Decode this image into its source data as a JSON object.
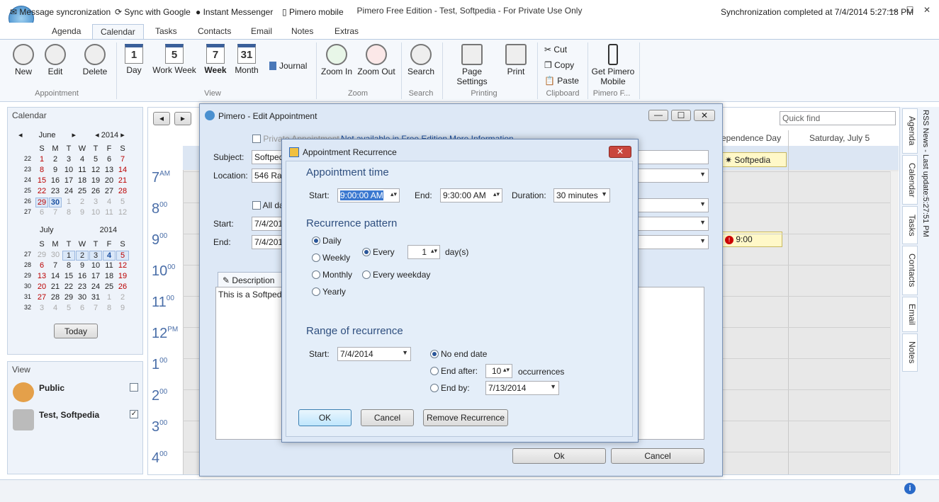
{
  "app": {
    "title": "Pimero Free Edition - Test, Softpedia - For Private Use Only"
  },
  "tabs": [
    "Agenda",
    "Calendar",
    "Tasks",
    "Contacts",
    "Email",
    "Notes",
    "Extras"
  ],
  "ribbon": {
    "new": "New",
    "edit": "Edit",
    "delete": "Delete",
    "group_appointment": "Appointment",
    "day": "Day",
    "work_week": "Work Week",
    "week": "Week",
    "month": "Month",
    "journal": "Journal",
    "group_view": "View",
    "day_num": "1",
    "work_week_num": "5",
    "week_num": "7",
    "month_num": "31",
    "zoom_in": "Zoom In",
    "zoom_out": "Zoom Out",
    "group_zoom": "Zoom",
    "search": "Search",
    "group_search": "Search",
    "page_settings": "Page Settings",
    "print": "Print",
    "group_printing": "Printing",
    "cut": "Cut",
    "copy": "Copy",
    "paste": "Paste",
    "group_clipboard": "Clipboard",
    "get_mobile": "Get Pimero Mobile",
    "group_pimero": "Pimero F..."
  },
  "calendar_pane": {
    "title": "Calendar",
    "today": "Today",
    "june": {
      "month": "June",
      "year": "2014"
    },
    "july": {
      "month": "July",
      "year": "2014"
    },
    "weekdays": [
      "S",
      "M",
      "T",
      "W",
      "T",
      "F",
      "S"
    ]
  },
  "view_pane": {
    "title": "View",
    "items": [
      {
        "label": "Public"
      },
      {
        "label": "Test, Softpedia"
      }
    ]
  },
  "main": {
    "quick_find": "Quick find",
    "col_independence": "ependence Day",
    "col_saturday": "Saturday, July 5",
    "event_softpedia": "Softpedia",
    "event_900": "9:00",
    "hours": [
      {
        "h": "7",
        "s": "AM"
      },
      {
        "h": "8",
        "s": "00"
      },
      {
        "h": "9",
        "s": "00"
      },
      {
        "h": "10",
        "s": "00"
      },
      {
        "h": "11",
        "s": "00"
      },
      {
        "h": "12",
        "s": "PM"
      },
      {
        "h": "1",
        "s": "00"
      },
      {
        "h": "2",
        "s": "00"
      },
      {
        "h": "3",
        "s": "00"
      },
      {
        "h": "4",
        "s": "00"
      }
    ]
  },
  "side_tabs": [
    "RSS News - Last update:5:27:51 PM",
    "Agenda",
    "Calendar",
    "Tasks",
    "Contacts",
    "Email",
    "Notes"
  ],
  "edit_dialog": {
    "title": "Pimero - Edit Appointment",
    "private": "Private Appointment",
    "not_available": "Not available in Free Edition",
    "more_info": "More Information",
    "subject_label": "Subject:",
    "subject_value": "Softped",
    "location_label": "Location:",
    "location_value": "546 Ray",
    "all_day": "All da",
    "start_label": "Start:",
    "start_value": "7/4/201",
    "end_label": "End:",
    "end_value": "7/4/201",
    "description_tab": "Description",
    "description_text": "This is a Softpedia",
    "ok": "Ok",
    "cancel": "Cancel"
  },
  "recurrence_dialog": {
    "title": "Appointment Recurrence",
    "appt_time": "Appointment time",
    "start_label": "Start:",
    "start_value": "9:00:00 AM",
    "end_label": "End:",
    "end_value": "9:30:00 AM",
    "duration_label": "Duration:",
    "duration_value": "30 minutes",
    "pattern": "Recurrence pattern",
    "daily": "Daily",
    "weekly": "Weekly",
    "monthly": "Monthly",
    "yearly": "Yearly",
    "every": "Every",
    "every_value": "1",
    "days": "day(s)",
    "every_weekday": "Every weekday",
    "range": "Range of recurrence",
    "range_start_label": "Start:",
    "range_start_value": "7/4/2014",
    "no_end": "No end date",
    "end_after": "End after:",
    "end_after_value": "10",
    "occurrences": "occurrences",
    "end_by": "End by:",
    "end_by_value": "7/13/2014",
    "ok": "OK",
    "cancel": "Cancel",
    "remove": "Remove Recurrence"
  },
  "status": {
    "msg_sync": "Message syncronization",
    "google": "Sync with Google",
    "im": "Instant Messenger",
    "mobile": "Pimero mobile",
    "completed": "Synchronization completed at 7/4/2014 5:27:18 PM"
  }
}
